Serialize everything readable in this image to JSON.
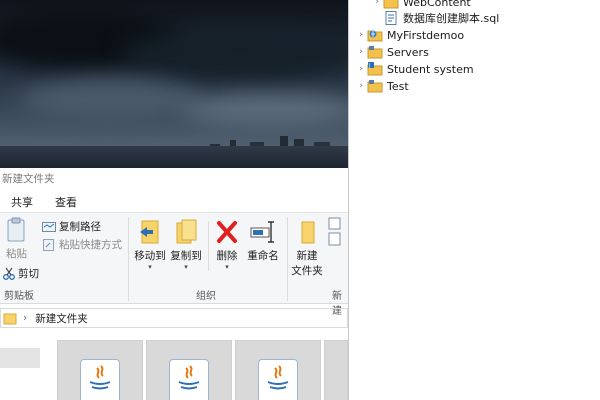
{
  "explorer": {
    "window_title": "新建文件夹",
    "menu_tabs": [
      "共享",
      "查看"
    ],
    "ribbon": {
      "paste": "粘贴",
      "copy_path": "复制路径",
      "paste_shortcut": "粘贴快捷方式",
      "cut": "剪切",
      "move_to": "移动到",
      "copy_to": "复制到",
      "delete": "删除",
      "rename": "重命名",
      "new_folder_line1": "新建",
      "new_folder_line2": "文件夹",
      "group_clipboard": "剪贴板",
      "group_organize": "组织",
      "group_new": "新建"
    },
    "address": {
      "separator": "›",
      "path": "新建文件夹"
    }
  },
  "eclipse": {
    "tree": [
      {
        "label": "WebContent",
        "icon": "folder-icon",
        "twisty": "›"
      },
      {
        "label": "数据库创建脚本.sql",
        "icon": "sql-file-icon",
        "twisty": ""
      },
      {
        "label": "MyFirstdemoo",
        "icon": "web-project-icon",
        "twisty": "›"
      },
      {
        "label": "Servers",
        "icon": "project-folder-icon",
        "twisty": "›"
      },
      {
        "label": "Student system",
        "icon": "java-project-icon",
        "twisty": "›"
      },
      {
        "label": "Test",
        "icon": "project-folder-icon",
        "twisty": "›"
      }
    ]
  },
  "colors": {
    "delete_red": "#e02020",
    "folder_yellow": "#f2c14e",
    "java_orange": "#e07a10",
    "java_blue": "#2f6fb3"
  }
}
